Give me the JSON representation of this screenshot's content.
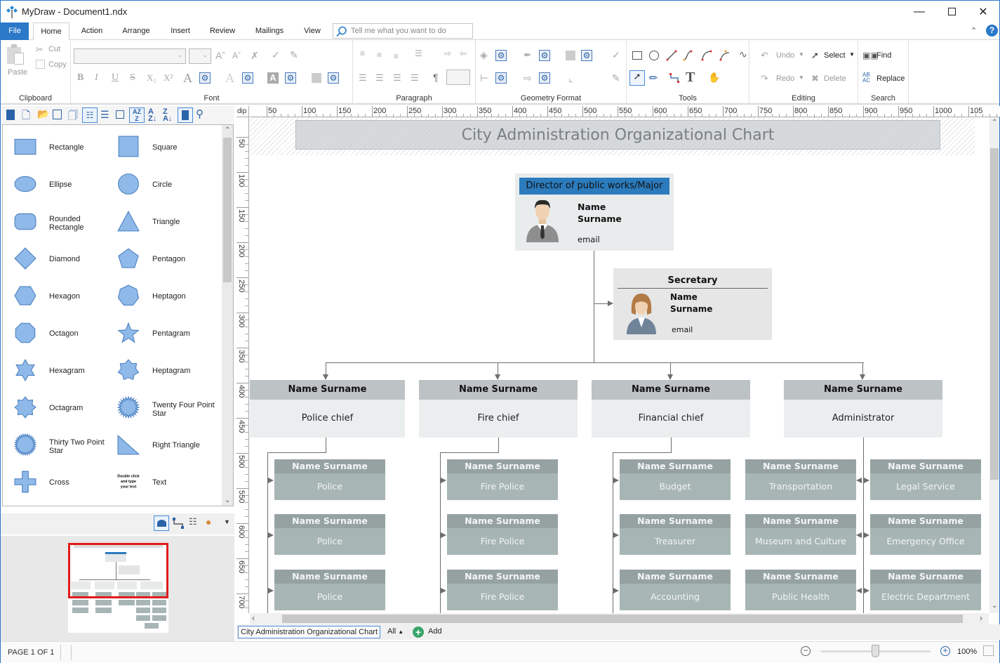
{
  "window": {
    "title": "MyDraw - Document1.ndx",
    "minimize_icon": "minimize-icon",
    "maximize_icon": "maximize-icon",
    "close_icon": "close-icon"
  },
  "menu": {
    "file": "File",
    "tabs": [
      "Home",
      "Action",
      "Arrange",
      "Insert",
      "Review",
      "Mailings",
      "View"
    ],
    "active_tab": "Home",
    "tell_me_placeholder": "Tell me what you want to do"
  },
  "ribbon": {
    "clipboard": {
      "label": "Clipboard",
      "paste": "Paste",
      "cut": "Cut",
      "copy": "Copy"
    },
    "font": {
      "label": "Font",
      "font_name": "",
      "font_size": ""
    },
    "paragraph": {
      "label": "Paragraph"
    },
    "geometry_format": {
      "label": "Geometry Format"
    },
    "tools": {
      "label": "Tools"
    },
    "editing": {
      "label": "Editing",
      "undo": "Undo",
      "redo": "Redo",
      "select": "Select",
      "delete": "Delete"
    },
    "search": {
      "label": "Search",
      "find": "Find",
      "replace": "Replace"
    }
  },
  "shapes_panel": {
    "items": [
      {
        "label": "Rectangle",
        "icon": "rectangle"
      },
      {
        "label": "Square",
        "icon": "square"
      },
      {
        "label": "Ellipse",
        "icon": "ellipse"
      },
      {
        "label": "Circle",
        "icon": "circle"
      },
      {
        "label": "Rounded Rectangle",
        "icon": "rounded-rectangle"
      },
      {
        "label": "Triangle",
        "icon": "triangle"
      },
      {
        "label": "Diamond",
        "icon": "diamond"
      },
      {
        "label": "Pentagon",
        "icon": "pentagon"
      },
      {
        "label": "Hexagon",
        "icon": "hexagon"
      },
      {
        "label": "Heptagon",
        "icon": "heptagon"
      },
      {
        "label": "Octagon",
        "icon": "octagon"
      },
      {
        "label": "Pentagram",
        "icon": "pentagram"
      },
      {
        "label": "Hexagram",
        "icon": "hexagram"
      },
      {
        "label": "Heptagram",
        "icon": "heptagram"
      },
      {
        "label": "Octagram",
        "icon": "octagram"
      },
      {
        "label": "Twenty Four Point Star",
        "icon": "star-24"
      },
      {
        "label": "Thirty Two Point Star",
        "icon": "star-32"
      },
      {
        "label": "Right Triangle",
        "icon": "right-triangle"
      },
      {
        "label": "Cross",
        "icon": "cross"
      },
      {
        "label": "Text",
        "icon": "text",
        "preview": "Double click and type your text"
      }
    ]
  },
  "ruler": {
    "unit": "dip",
    "h_ticks": [
      "50",
      "100",
      "150",
      "200",
      "250",
      "300",
      "350",
      "400",
      "450",
      "500",
      "550",
      "600",
      "650",
      "700",
      "750",
      "800",
      "850",
      "900",
      "950",
      "1000",
      "105"
    ],
    "v_ticks": [
      "50",
      "100",
      "150",
      "200",
      "250",
      "300",
      "350",
      "400",
      "450",
      "500",
      "550",
      "600",
      "650",
      "700"
    ]
  },
  "diagram": {
    "title": "City Administration Organizational Chart",
    "director": {
      "header": "Director of public works/Major",
      "name": "Name",
      "surname": "Surname",
      "email": "email"
    },
    "secretary": {
      "header": "Secretary",
      "name": "Name",
      "surname": "Surname",
      "email": "email"
    },
    "chiefs": [
      {
        "name": "Name Surname",
        "role": "Police chief"
      },
      {
        "name": "Name Surname",
        "role": "Fire chief"
      },
      {
        "name": "Name Surname",
        "role": "Financial chief"
      },
      {
        "name": "Name Surname",
        "role": "Administrator"
      }
    ],
    "subordinates": {
      "police": [
        {
          "name": "Name Surname",
          "role": "Police"
        },
        {
          "name": "Name Surname",
          "role": "Police"
        },
        {
          "name": "Name Surname",
          "role": "Police"
        }
      ],
      "fire": [
        {
          "name": "Name Surname",
          "role": "Fire Police"
        },
        {
          "name": "Name Surname",
          "role": "Fire Police"
        },
        {
          "name": "Name Surname",
          "role": "Fire Police"
        }
      ],
      "finance": [
        {
          "name": "Name Surname",
          "role": "Budget"
        },
        {
          "name": "Name Surname",
          "role": "Treasurer"
        },
        {
          "name": "Name Surname",
          "role": "Accounting"
        }
      ],
      "admin_left": [
        {
          "name": "Name Surname",
          "role": "Transportation"
        },
        {
          "name": "Name Surname",
          "role": "Museum and Culture"
        },
        {
          "name": "Name Surname",
          "role": "Public Health"
        }
      ],
      "admin_right": [
        {
          "name": "Name Surname",
          "role": "Legal Service"
        },
        {
          "name": "Name Surname",
          "role": "Emergency Office"
        },
        {
          "name": "Name Surname",
          "role": "Electric Department"
        }
      ]
    }
  },
  "pages_bar": {
    "current_page_tab": "City Administration Organizational Chart",
    "all_label": "All",
    "add_label": "Add"
  },
  "status": {
    "page_indicator": "PAGE 1 OF 1",
    "zoom_value": "100%",
    "zoom_fraction": 0.5
  },
  "colors": {
    "accent": "#2b79c9",
    "director_header": "#2b7bbd",
    "chief_header": "#bdc2c5",
    "chief_body": "#eaeeef",
    "sub_header": "#96a2a2",
    "sub_body": "#a8b5b5",
    "shape_fill": "#8fb9e8",
    "shape_stroke": "#4a7fc1"
  }
}
